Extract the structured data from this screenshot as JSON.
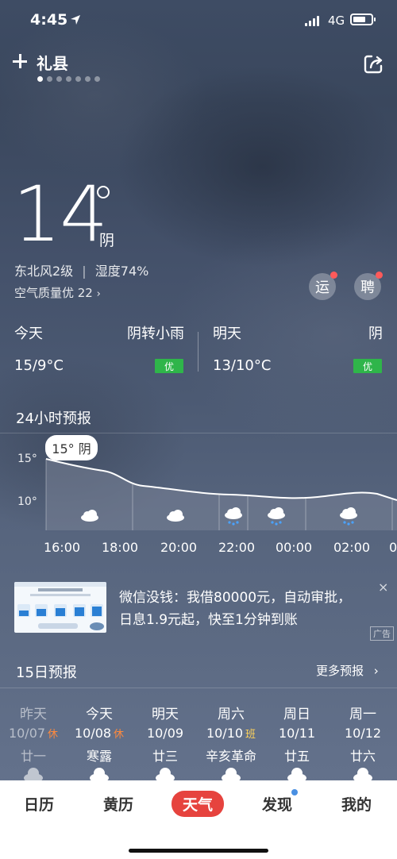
{
  "status": {
    "time": "4:45",
    "network": "4G"
  },
  "header": {
    "city": "礼县"
  },
  "current": {
    "temp": "14",
    "condition": "阴",
    "wind": "东北风2级",
    "humidity": "湿度74%",
    "aqi": "空气质量优 22",
    "bubble_1": "运",
    "bubble_2": "聘"
  },
  "today": {
    "label": "今天",
    "condition": "阴转小雨",
    "range": "15/9°C",
    "aq": "优"
  },
  "tomorrow": {
    "label": "明天",
    "condition": "阴",
    "range": "13/10°C",
    "aq": "优"
  },
  "hourly": {
    "title": "24小时预报",
    "axis_high": "15°",
    "axis_low": "10°",
    "tooltip": "15° 阴",
    "times": [
      "16:00",
      "18:00",
      "20:00",
      "22:00",
      "00:00",
      "02:00",
      "0"
    ],
    "icons": [
      "cloud-icon",
      "cloud-icon",
      "rain-cloud-icon",
      "rain-cloud-icon",
      "rain-cloud-icon"
    ]
  },
  "ad": {
    "text": "微信没钱：我借80000元，自动审批，日息1.9元起，快至1分钟到账",
    "tag": "广告",
    "close": "×"
  },
  "daily": {
    "title": "15日预报",
    "more": "更多预报",
    "days": [
      {
        "name": "昨天",
        "date": "10/07",
        "tag": "休",
        "lunar": "廿一"
      },
      {
        "name": "今天",
        "date": "10/08",
        "tag": "休",
        "lunar": "寒露"
      },
      {
        "name": "明天",
        "date": "10/09",
        "tag": "",
        "lunar": "廿三"
      },
      {
        "name": "周六",
        "date": "10/10",
        "tag": "班",
        "lunar": "辛亥革命"
      },
      {
        "name": "周日",
        "date": "10/11",
        "tag": "",
        "lunar": "廿五"
      },
      {
        "name": "周一",
        "date": "10/12",
        "tag": "",
        "lunar": "廿六"
      }
    ]
  },
  "nav": {
    "items": [
      "日历",
      "黄历",
      "天气",
      "发现",
      "我的"
    ],
    "active": "天气"
  }
}
